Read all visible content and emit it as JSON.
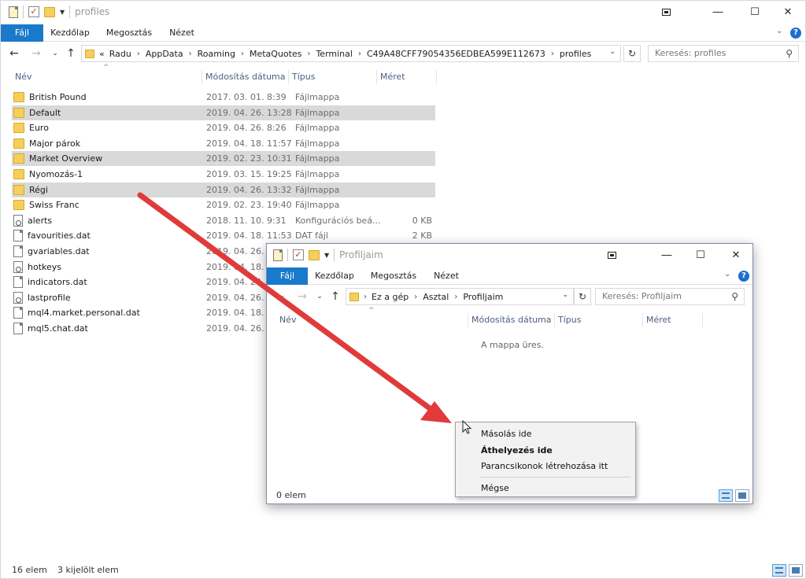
{
  "main": {
    "title": "profiles",
    "ribbon_tabs": [
      "Fájl",
      "Kezdőlap",
      "Megosztás",
      "Nézet"
    ],
    "help_glyph": "?",
    "breadcrumb_prefix": "«",
    "breadcrumb": [
      "Radu",
      "AppData",
      "Roaming",
      "MetaQuotes",
      "Terminal",
      "C49A48CFF79054356EDBEA599E112673",
      "profiles"
    ],
    "search_placeholder": "Keresés: profiles",
    "columns": {
      "name": "Név",
      "modified": "Módosítás dátuma",
      "type": "Típus",
      "size": "Méret"
    },
    "files": [
      {
        "name": "British Pound",
        "modified": "2017. 03. 01. 8:39",
        "type": "Fájlmappa",
        "size": "",
        "icon": "folder-icon",
        "selected": false
      },
      {
        "name": "Default",
        "modified": "2019. 04. 26. 13:28",
        "type": "Fájlmappa",
        "size": "",
        "icon": "folder-icon",
        "selected": true
      },
      {
        "name": "Euro",
        "modified": "2019. 04. 26. 8:26",
        "type": "Fájlmappa",
        "size": "",
        "icon": "folder-icon",
        "selected": false
      },
      {
        "name": "Major párok",
        "modified": "2019. 04. 18. 11:57",
        "type": "Fájlmappa",
        "size": "",
        "icon": "folder-icon",
        "selected": false
      },
      {
        "name": "Market Overview",
        "modified": "2019. 02. 23. 10:31",
        "type": "Fájlmappa",
        "size": "",
        "icon": "folder-icon",
        "selected": true
      },
      {
        "name": "Nyomozás-1",
        "modified": "2019. 03. 15. 19:25",
        "type": "Fájlmappa",
        "size": "",
        "icon": "folder-icon",
        "selected": false
      },
      {
        "name": "Régi",
        "modified": "2019. 04. 26. 13:32",
        "type": "Fájlmappa",
        "size": "",
        "icon": "folder-icon",
        "selected": true
      },
      {
        "name": "Swiss Franc",
        "modified": "2019. 02. 23. 19:40",
        "type": "Fájlmappa",
        "size": "",
        "icon": "folder-icon",
        "selected": false
      },
      {
        "name": "alerts",
        "modified": "2018. 11. 10. 9:31",
        "type": "Konfigurációs beá...",
        "size": "0 KB",
        "icon": "config-file-icon",
        "selected": false
      },
      {
        "name": "favourities.dat",
        "modified": "2019. 04. 18. 11:53",
        "type": "DAT fájl",
        "size": "2 KB",
        "icon": "file-icon",
        "selected": false
      },
      {
        "name": "gvariables.dat",
        "modified": "2019. 04. 26. 13",
        "type": "",
        "size": "",
        "icon": "file-icon",
        "selected": false
      },
      {
        "name": "hotkeys",
        "modified": "2019. 04. 18. 11:",
        "type": "",
        "size": "",
        "icon": "config-file-icon",
        "selected": false
      },
      {
        "name": "indicators.dat",
        "modified": "2019. 04. 24.",
        "type": "",
        "size": "",
        "icon": "file-icon",
        "selected": false
      },
      {
        "name": "lastprofile",
        "modified": "2019. 04. 26. 13",
        "type": "",
        "size": "",
        "icon": "config-file-icon",
        "selected": false
      },
      {
        "name": "mql4.market.personal.dat",
        "modified": "2019. 04. 18. 15:",
        "type": "",
        "size": "",
        "icon": "file-icon",
        "selected": false
      },
      {
        "name": "mql5.chat.dat",
        "modified": "2019. 04. 26. 13:",
        "type": "",
        "size": "",
        "icon": "file-icon",
        "selected": false
      }
    ],
    "status_count": "16 elem",
    "status_selected": "3 kijelölt elem"
  },
  "second": {
    "title": "Profiljaim",
    "ribbon_tabs": [
      "Fájl",
      "Kezdőlap",
      "Megosztás",
      "Nézet"
    ],
    "help_glyph": "?",
    "breadcrumb": [
      "Ez a gép",
      "Asztal",
      "Profiljaim"
    ],
    "search_placeholder": "Keresés: Profiljaim",
    "columns": {
      "name": "Név",
      "modified": "Módosítás dátuma",
      "type": "Típus",
      "size": "Méret"
    },
    "empty_message": "A mappa üres.",
    "status_count": "0 elem"
  },
  "context_menu": {
    "items": [
      "Másolás ide",
      "Áthelyezés ide",
      "Parancsikonok létrehozása itt",
      "Mégse"
    ],
    "default_item": "Áthelyezés ide"
  },
  "colors": {
    "file_tab": "#1979ca",
    "selection": "#d9d9d9",
    "folder": "#f6cf5a",
    "arrow": "#e03a3a",
    "header_text": "#4d6082"
  }
}
